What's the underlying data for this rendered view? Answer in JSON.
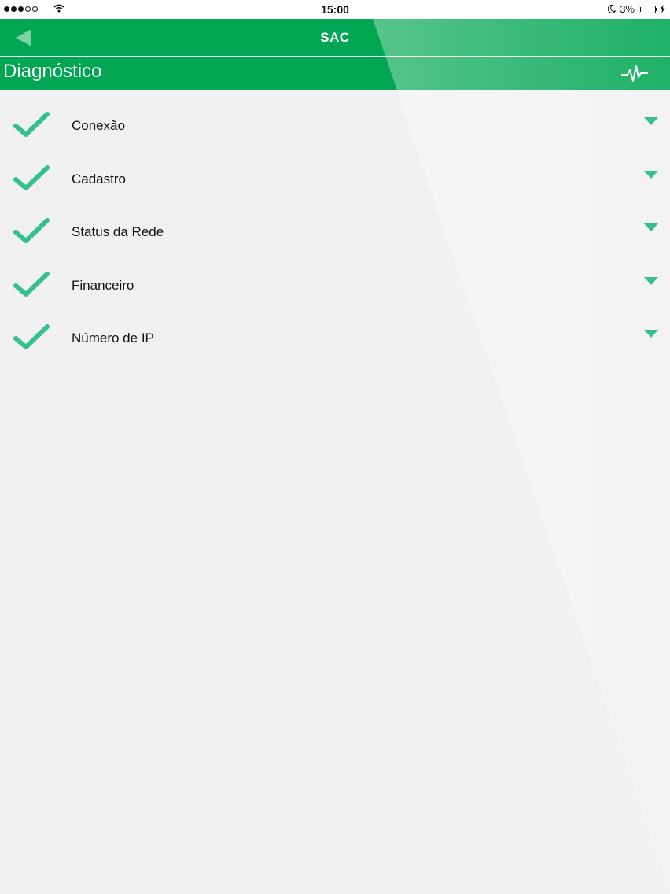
{
  "status_bar": {
    "time": "15:00",
    "battery_percent": "3%",
    "signal_bars_filled": 3,
    "signal_bars_total": 5,
    "battery_fraction": 0.03,
    "icons": [
      "signal-dots",
      "wifi-icon",
      "moon-icon",
      "battery-icon",
      "charging-bolt-icon"
    ]
  },
  "nav": {
    "title": "SAC",
    "back_icon": "back-arrow-icon"
  },
  "section": {
    "title": "Diagnóstico",
    "action_icon": "pulse-icon"
  },
  "diagnostics": {
    "items": [
      {
        "label": "Conexão",
        "status_icon": "checkmark-icon",
        "expand_icon": "chevron-down-icon"
      },
      {
        "label": "Cadastro",
        "status_icon": "checkmark-icon",
        "expand_icon": "chevron-down-icon"
      },
      {
        "label": "Status da Rede",
        "status_icon": "checkmark-icon",
        "expand_icon": "chevron-down-icon"
      },
      {
        "label": "Financeiro",
        "status_icon": "checkmark-icon",
        "expand_icon": "chevron-down-icon"
      },
      {
        "label": "Número de IP",
        "status_icon": "checkmark-icon",
        "expand_icon": "chevron-down-icon"
      }
    ]
  },
  "colors": {
    "brand_green": "#00a651",
    "check_green": "#33c08a",
    "page_background": "#f1f1f3",
    "header_text": "#ffffff"
  }
}
